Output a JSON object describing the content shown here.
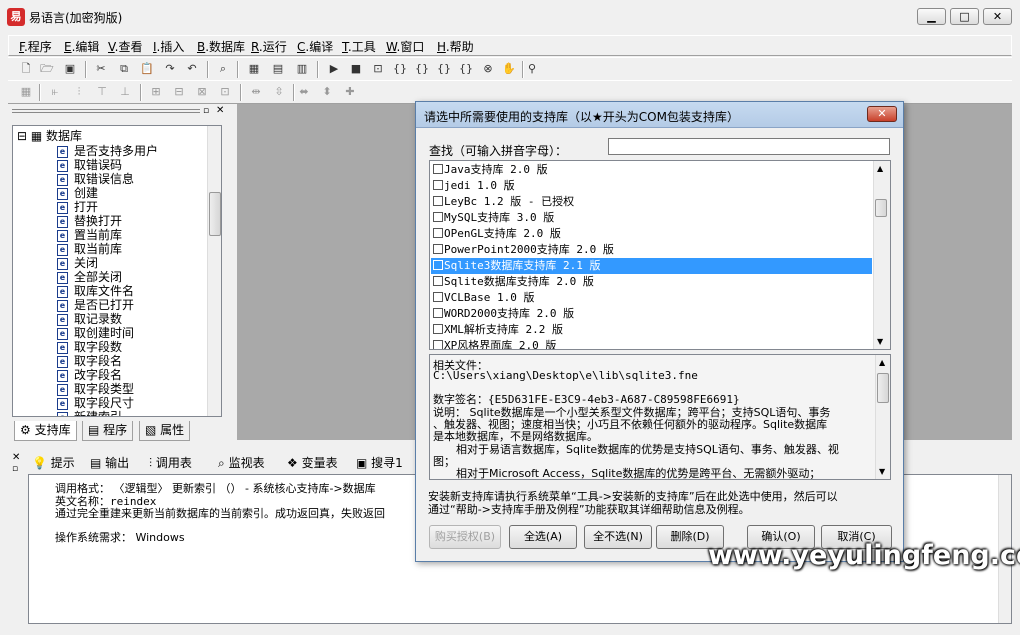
{
  "window": {
    "title": "易语言(加密狗版)"
  },
  "menu": [
    {
      "key": "F",
      "label": ".程序"
    },
    {
      "key": "E",
      "label": ".编辑"
    },
    {
      "key": "V",
      "label": ".查看"
    },
    {
      "key": "I",
      "label": ".插入"
    },
    {
      "key": "B",
      "label": ".数据库"
    },
    {
      "key": "R",
      "label": ".运行"
    },
    {
      "key": "C",
      "label": ".编译"
    },
    {
      "key": "T",
      "label": ".工具"
    },
    {
      "key": "W",
      "label": ".窗口"
    },
    {
      "key": "H",
      "label": ".帮助"
    }
  ],
  "tree": {
    "root": "数据库",
    "items": [
      "是否支持多用户",
      "取错误码",
      "取错误信息",
      "创建",
      "打开",
      "替换打开",
      "置当前库",
      "取当前库",
      "关闭",
      "全部关闭",
      "取库文件名",
      "是否已打开",
      "取记录数",
      "取创建时间",
      "取字段数",
      "取字段名",
      "改字段名",
      "取字段类型",
      "取字段尺寸",
      "新建索引"
    ]
  },
  "panel_tabs": [
    "支持库",
    "程序",
    "属性"
  ],
  "bottom_tabs": [
    "提示",
    "输出",
    "调用表",
    "监视表",
    "变量表",
    "搜寻1"
  ],
  "bottom_content": {
    "line1": "调用格式： 〈逻辑型〉 更新索引 （） - 系统核心支持库->数据库",
    "line2": "英文名称：reindex",
    "line3": "通过完全重建来更新当前数据库的当前索引。成功返回真，失败返回",
    "line4": "操作系统需求： Windows"
  },
  "dialog": {
    "title": "请选中所需要使用的支持库（以★开头为COM包装支持库）",
    "search_label": "查找（可输入拼音字母）：",
    "search_value": "",
    "list": [
      {
        "label": "Java支持库 2.0 版",
        "checked": false,
        "selected": false
      },
      {
        "label": "jedi 1.0 版",
        "checked": false,
        "selected": false
      },
      {
        "label": "LeyBc 1.2 版 - 已授权",
        "checked": false,
        "selected": false
      },
      {
        "label": "MySQL支持库 3.0 版",
        "checked": false,
        "selected": false
      },
      {
        "label": "OPenGL支持库 2.0 版",
        "checked": false,
        "selected": false
      },
      {
        "label": "PowerPoint2000支持库 2.0 版",
        "checked": false,
        "selected": false
      },
      {
        "label": "Sqlite3数据库支持库 2.1 版",
        "checked": false,
        "selected": true
      },
      {
        "label": "Sqlite数据库支持库 2.0 版",
        "checked": false,
        "selected": false
      },
      {
        "label": "VCLBase 1.0 版",
        "checked": false,
        "selected": false
      },
      {
        "label": "WORD2000支持库 2.0 版",
        "checked": false,
        "selected": false
      },
      {
        "label": "XML解析支持库 2.2 版",
        "checked": false,
        "selected": false
      },
      {
        "label": "XP风格界面库 2.0 版",
        "checked": false,
        "selected": false
      }
    ],
    "info": {
      "file_label": "相关文件：",
      "file_path": "C:\\Users\\xiang\\Desktop\\e\\lib\\sqlite3.fne",
      "sig": "数字签名：{E5D631FE-E3C9-4eb3-A687-C89598FE6691}",
      "desc1": "说明： Sqlite数据库是一个小型关系型文件数据库；跨平台；支持SQL语句、事务",
      "desc2": "、触发器、视图；速度相当快；小巧且不依赖任何额外的驱动程序。Sqlite数据库",
      "desc3": "是本地数据库，不是网络数据库。",
      "desc4": "相对于易语言数据库，Sqlite数据库的优势是支持SQL语句、事务、触发器、视",
      "desc5": "图；",
      "desc6": "相对于Microsoft Access，Sqlite数据库的优势是跨平台、无需额外驱动；"
    },
    "note1": "安装新支持库请执行系统菜单“工具->安装新的支持库”后在此处选中使用，然后可以",
    "note2": "通过“帮助->支持库手册及例程”功能获取其详细帮助信息及例程。",
    "buttons": {
      "buy": "购买授权(B)",
      "select_all": "全选(A)",
      "select_none": "全不选(N)",
      "delete": "删除(D)",
      "ok": "确认(O)",
      "cancel": "取消(C)"
    }
  },
  "watermark": "www.yeyulingfeng.com"
}
